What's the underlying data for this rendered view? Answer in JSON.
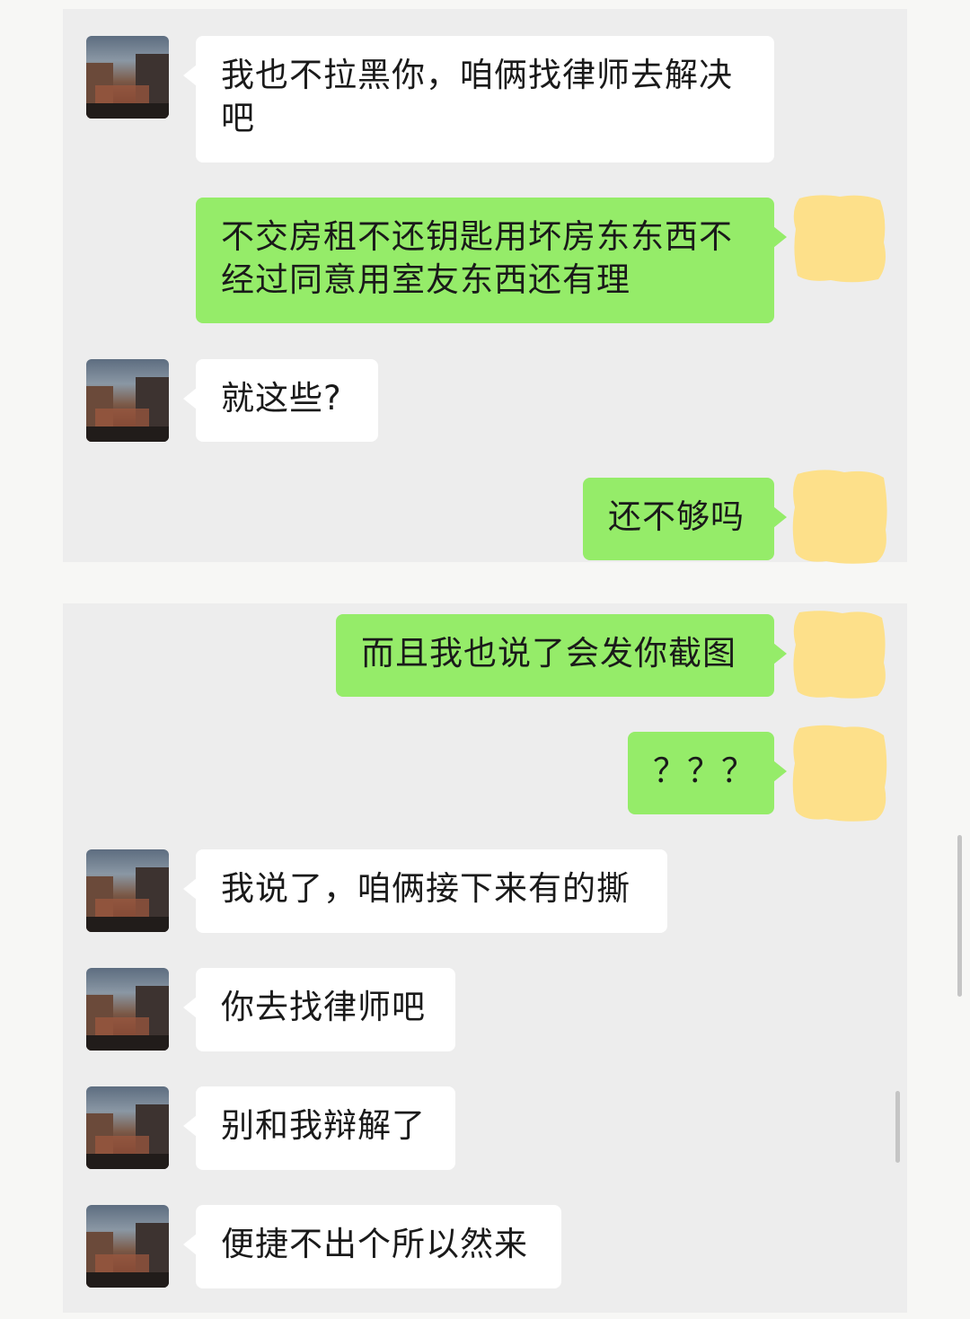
{
  "conversation": {
    "messages": [
      {
        "side": "in",
        "text": "我也不拉黑你，咱俩找律师去解决吧"
      },
      {
        "side": "out",
        "text": "不交房租不还钥匙用坏房东东西不经过同意用室友东西还有理"
      },
      {
        "side": "in",
        "text": "就这些?"
      },
      {
        "side": "out",
        "text": "还不够吗"
      },
      {
        "side": "out",
        "text": "而且我也说了会发你截图"
      },
      {
        "side": "out",
        "text": "？？？"
      },
      {
        "side": "in",
        "text": "我说了，咱俩接下来有的撕"
      },
      {
        "side": "in",
        "text": "你去找律师吧"
      },
      {
        "side": "in",
        "text": "别和我辩解了"
      },
      {
        "side": "in",
        "text": "便捷不出个所以然来"
      }
    ]
  },
  "colors": {
    "incoming_bubble": "#ffffff",
    "outgoing_bubble": "#95ec69",
    "chat_background": "#ededed",
    "censor_blur": "#fde08a"
  },
  "icons": {
    "contact_avatar": "building-photo-avatar",
    "self_avatar": "blurred-avatar"
  }
}
